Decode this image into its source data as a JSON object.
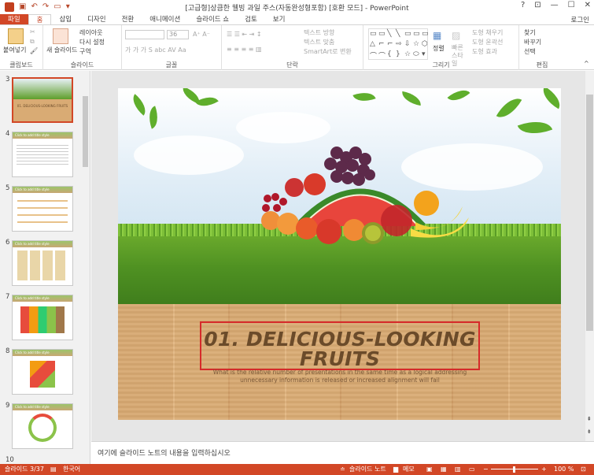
{
  "window": {
    "title": "[고급형]상큼한 웰빙 과일 주스(자동완성형포함) [호환 모드] - PowerPoint",
    "login": "로그인"
  },
  "tabs": [
    {
      "label": "파일"
    },
    {
      "label": "홈"
    },
    {
      "label": "삽입"
    },
    {
      "label": "디자인"
    },
    {
      "label": "전환"
    },
    {
      "label": "애니메이션"
    },
    {
      "label": "슬라이드 쇼"
    },
    {
      "label": "검토"
    },
    {
      "label": "보기"
    }
  ],
  "ribbon": {
    "clipboard": {
      "label": "클립보드",
      "paste": "붙여넣기"
    },
    "slides": {
      "label": "슬라이드",
      "new_slide": "새 슬라이드",
      "layout": "레이아웃",
      "reset": "다시 설정",
      "section": "구역"
    },
    "font": {
      "label": "글꼴",
      "size": "36"
    },
    "paragraph": {
      "label": "단락",
      "text_direction": "텍스트 방향",
      "align_text": "텍스트 맞춤",
      "smartart": "SmartArt로 변환"
    },
    "drawing": {
      "label": "그리기",
      "arrange": "정렬",
      "quick_styles": "빠른 스타일",
      "fill": "도형 채우기",
      "outline": "도형 윤곽선",
      "effects": "도형 효과"
    },
    "editing": {
      "label": "편집",
      "find": "찾기",
      "replace": "바꾸기",
      "select": "선택"
    }
  },
  "thumbnails": [
    {
      "number": "3",
      "title": "01. DELICIOUS-LOOKING FRUITS"
    },
    {
      "number": "4",
      "title": "Click to add title style"
    },
    {
      "number": "5",
      "title": "Click to add title style"
    },
    {
      "number": "6",
      "title": "Click to add title style"
    },
    {
      "number": "7",
      "title": "Click to add title style"
    },
    {
      "number": "8",
      "title": "Click to add title style"
    },
    {
      "number": "9",
      "title": "Click to add title style"
    },
    {
      "number": "10",
      "title": ""
    }
  ],
  "slide": {
    "title_line1": "01. DELICIOUS-LOOKING",
    "title_line2": "FRUITS",
    "subtitle": "What is the relative number of presentations in the same time as a logical addressing unnecessary information is released or  increased alignment will fail"
  },
  "notes": {
    "placeholder": "여기에 슬라이드 노트의 내용을 입력하십시오"
  },
  "status": {
    "slide_counter": "슬라이드 3/37",
    "language": "한국어",
    "notes_toggle": "슬라이드 노트",
    "comments": "메모",
    "zoom": "100 %"
  },
  "colors": {
    "accent": "#d24726",
    "title_box": "#d62a2a",
    "title_text": "#6b4b2a"
  }
}
